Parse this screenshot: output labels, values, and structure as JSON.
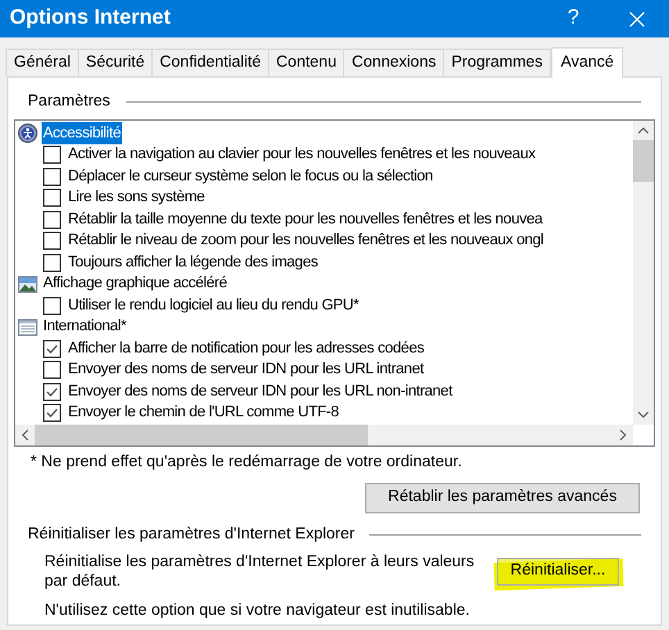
{
  "window": {
    "title": "Options Internet",
    "help": "?"
  },
  "tabs": [
    {
      "label": "Général",
      "selected": false
    },
    {
      "label": "Sécurité",
      "selected": false
    },
    {
      "label": "Confidentialité",
      "selected": false
    },
    {
      "label": "Contenu",
      "selected": false
    },
    {
      "label": "Connexions",
      "selected": false
    },
    {
      "label": "Programmes",
      "selected": false
    },
    {
      "label": "Avancé",
      "selected": true
    }
  ],
  "settings": {
    "label": "Paramètres",
    "groups": [
      {
        "kind": "accessibility",
        "label": "Accessibilité",
        "selected": true,
        "children": [
          {
            "label": "Activer la navigation au clavier pour les nouvelles fenêtres et les nouveaux",
            "checked": false
          },
          {
            "label": "Déplacer le curseur système selon le focus ou la sélection",
            "checked": false
          },
          {
            "label": "Lire les sons système",
            "checked": false
          },
          {
            "label": "Rétablir la taille moyenne du texte pour les nouvelles fenêtres et les nouvea",
            "checked": false
          },
          {
            "label": "Rétablir le niveau de zoom pour les nouvelles fenêtres et les nouveaux ongl",
            "checked": false
          },
          {
            "label": "Toujours afficher la légende des images",
            "checked": false
          }
        ]
      },
      {
        "kind": "graphics",
        "label": "Affichage graphique accéléré",
        "selected": false,
        "children": [
          {
            "label": "Utiliser le rendu logiciel au lieu du rendu GPU*",
            "checked": false
          }
        ]
      },
      {
        "kind": "international",
        "label": "International*",
        "selected": false,
        "children": [
          {
            "label": "Afficher la barre de notification pour les adresses codées",
            "checked": true
          },
          {
            "label": "Envoyer des noms de serveur IDN pour les URL intranet",
            "checked": false
          },
          {
            "label": "Envoyer des noms de serveur IDN pour les URL non-intranet",
            "checked": true
          },
          {
            "label": "Envoyer le chemin de l'URL comme UTF-8",
            "checked": true
          }
        ]
      }
    ]
  },
  "footnote": "* Ne prend effet qu'après le redémarrage de votre ordinateur.",
  "restore_button": "Rétablir les paramètres avancés",
  "reset": {
    "label": "Réinitialiser les paramètres d'Internet Explorer",
    "description": "Réinitialise les paramètres d'Internet Explorer à leurs valeurs par défaut.",
    "button": "Réinitialiser...",
    "note": "N'utilisez cette option que si votre navigateur est inutilisable."
  }
}
